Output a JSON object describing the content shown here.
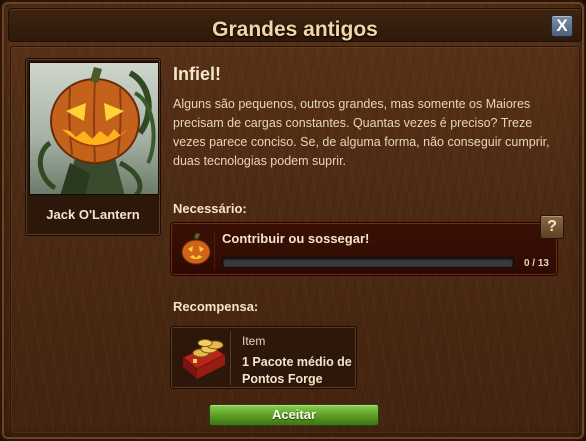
{
  "dialog": {
    "title": "Grandes antigos",
    "close_label": "X"
  },
  "character": {
    "name": "Jack O'Lantern",
    "portrait": "jack-o-lantern-portrait"
  },
  "quest": {
    "title": "Infiel!",
    "description": "Alguns são pequenos, outros grandes, mas somente os Maiores precisam de cargas constantes. Quantas vezes é preciso? Treze vezes parece conciso. Se, de alguma forma, não conseguir cumprir, duas tecnologias podem suprir."
  },
  "requirement": {
    "label": "Necessário:",
    "icon": "pumpkin-icon",
    "text": "Contribuir ou sossegar!",
    "progress_current": 0,
    "progress_total": 13,
    "progress_text": "0 / 13",
    "help_label": "?"
  },
  "reward": {
    "label": "Recompensa:",
    "icon": "forge-points-pack-icon",
    "type": "Item",
    "name": "1 Pacote médio de Pontos Forge"
  },
  "actions": {
    "accept_label": "Aceitar"
  },
  "colors": {
    "wood": "#4c2a13",
    "title_text": "#f0d7a8",
    "accept_green": "#5c9a26",
    "requirement_red": "#3b1005"
  }
}
